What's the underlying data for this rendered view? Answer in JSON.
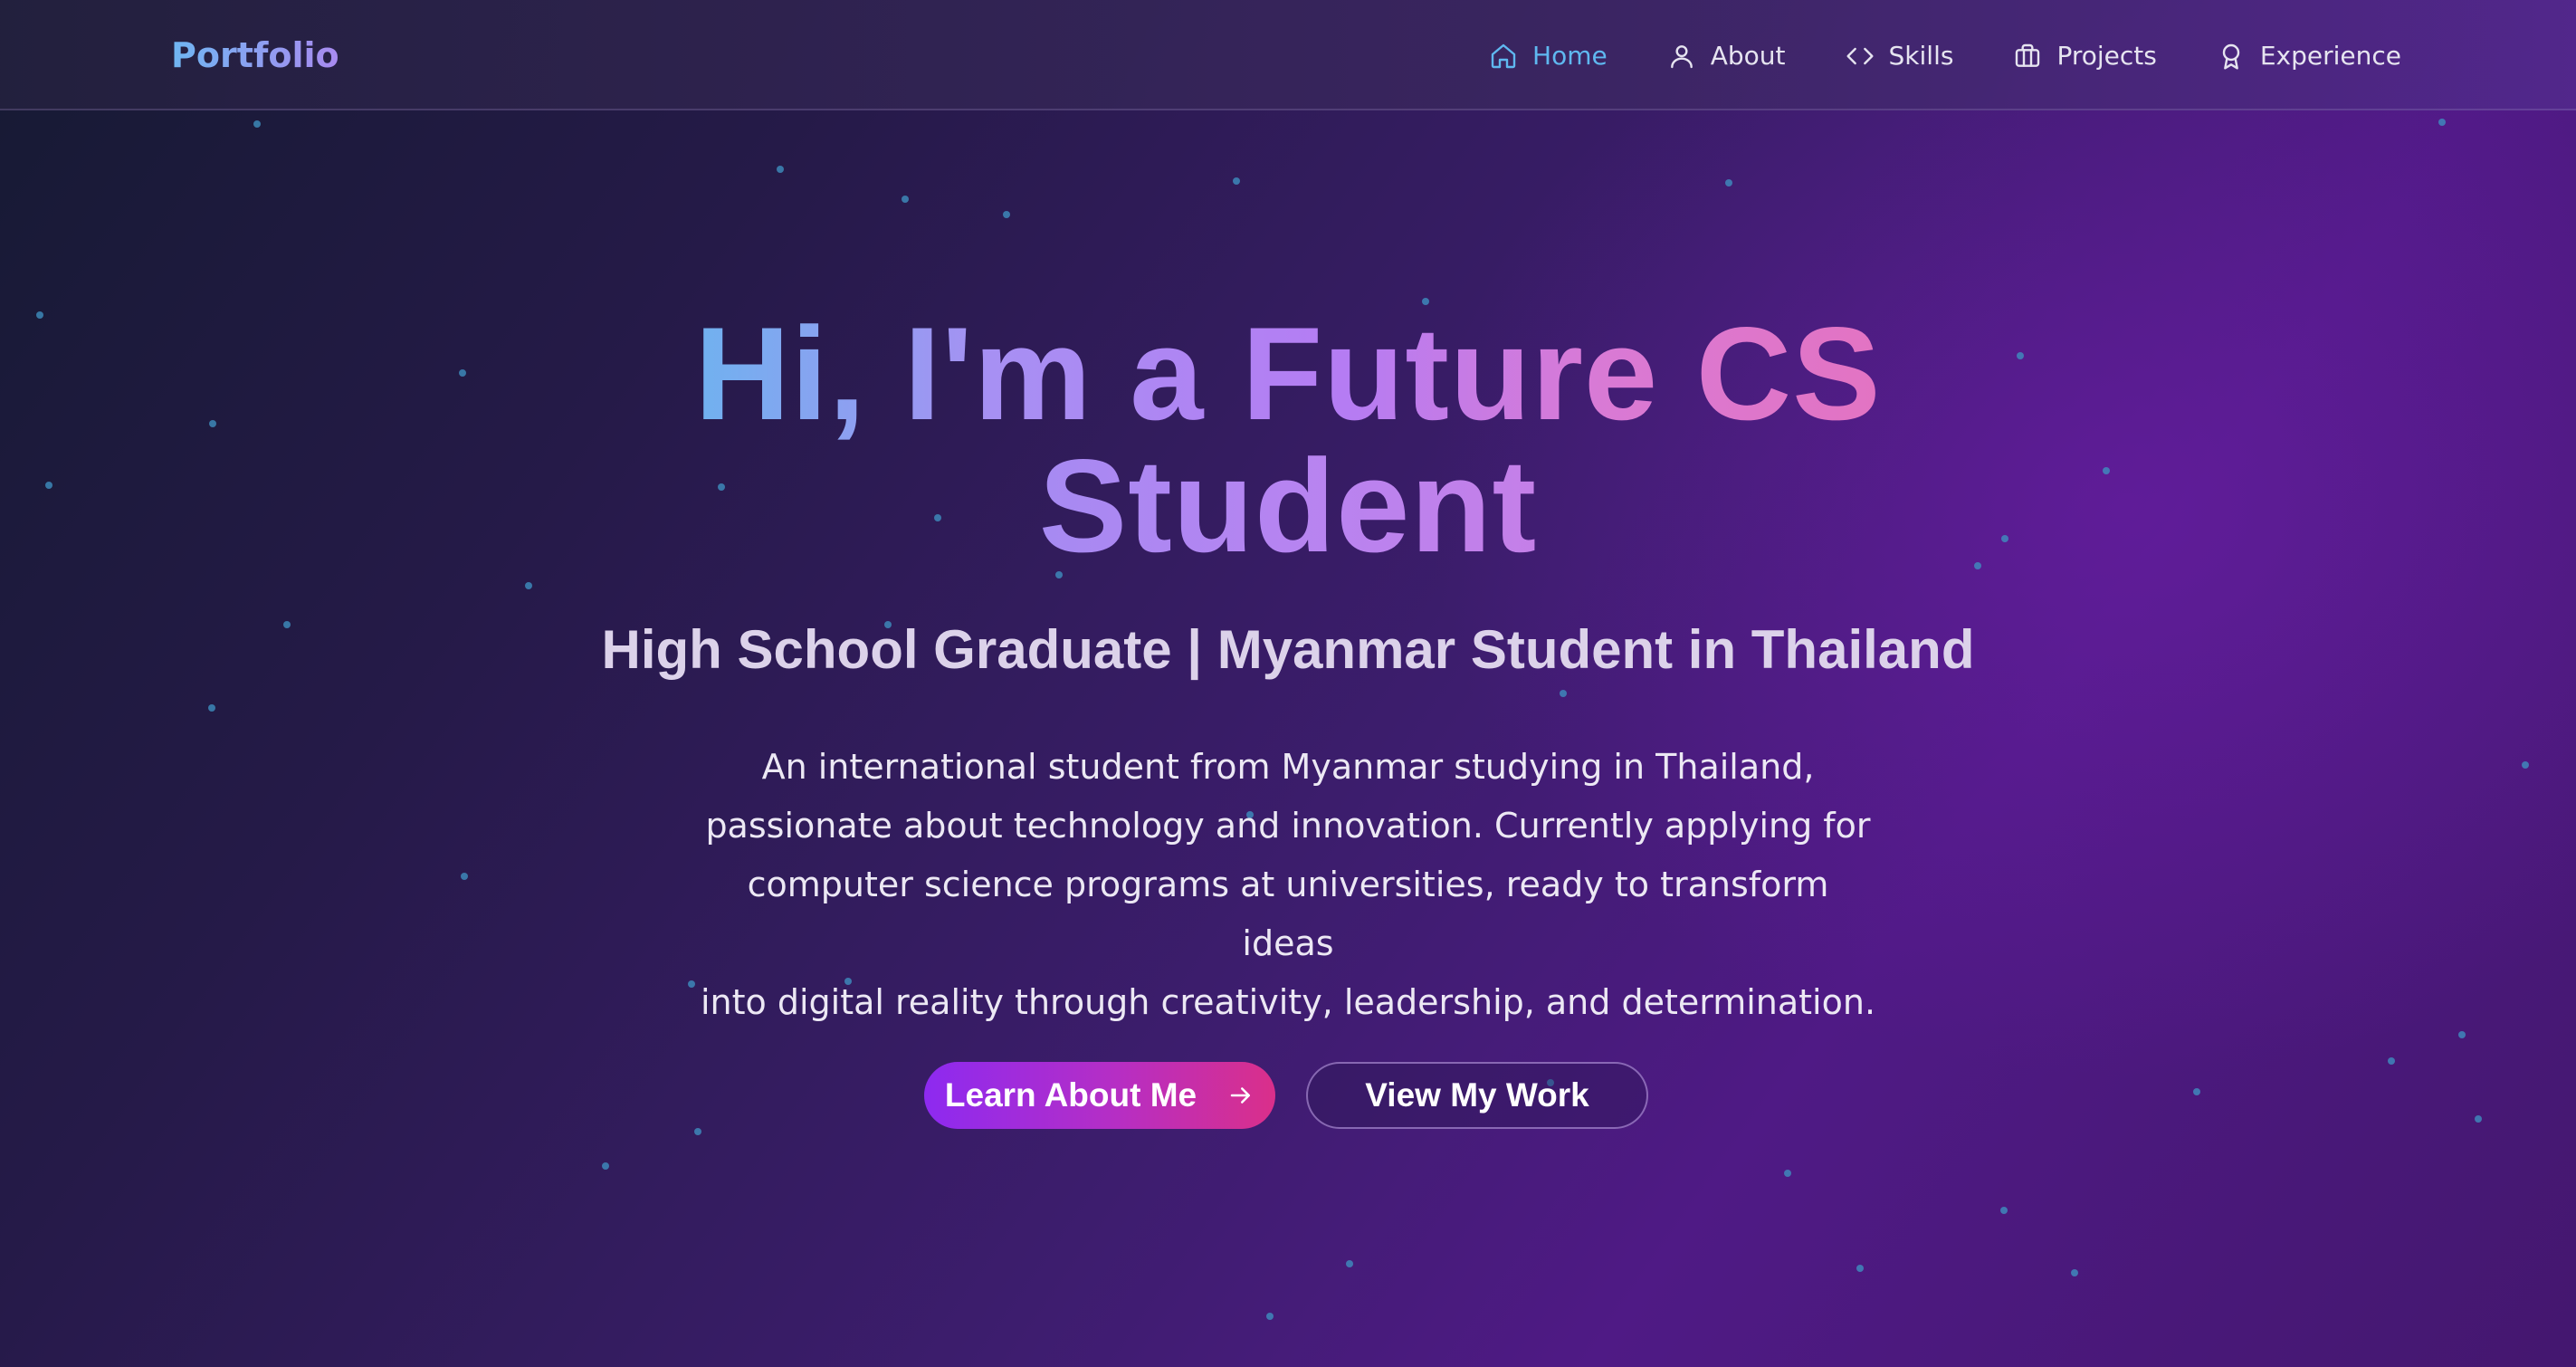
{
  "navbar": {
    "brand": "Portfolio",
    "items": [
      {
        "label": "Home",
        "icon": "home-icon",
        "active": true
      },
      {
        "label": "About",
        "icon": "user-icon",
        "active": false
      },
      {
        "label": "Skills",
        "icon": "code-icon",
        "active": false
      },
      {
        "label": "Projects",
        "icon": "briefcase-icon",
        "active": false
      },
      {
        "label": "Experience",
        "icon": "award-icon",
        "active": false
      }
    ]
  },
  "hero": {
    "title_line1_part1": "Hi, I'm a Future CS",
    "title_line2": "Student",
    "subtitle": "High School Graduate | Myanmar Student in Thailand",
    "description": [
      "An international student from Myanmar studying in Thailand,",
      "passionate about technology and innovation. Currently applying for",
      "computer science programs at universities, ready to transform ideas",
      "into digital reality through creativity, leadership, and determination."
    ],
    "primary_button": "Learn About Me",
    "secondary_button": "View My Work"
  },
  "colors": {
    "accent_blue": "#5fb8f0",
    "accent_purple": "#a98af0",
    "accent_pink": "#e373c2",
    "button_gradient_start": "#8d2af0",
    "button_gradient_end": "#da2f8a",
    "particle": "#3f8fbf"
  }
}
